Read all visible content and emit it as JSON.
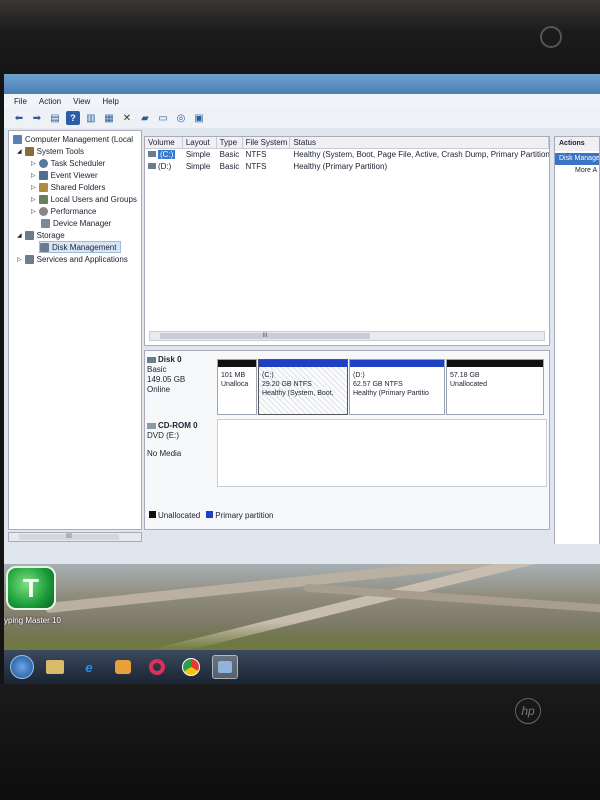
{
  "menu": [
    "File",
    "Action",
    "View",
    "Help"
  ],
  "toolbar": {
    "help_icon": "?"
  },
  "tree": {
    "items": [
      {
        "label": "Computer Management (Local"
      },
      {
        "label": "System Tools"
      },
      {
        "label": "Task Scheduler"
      },
      {
        "label": "Event Viewer"
      },
      {
        "label": "Shared Folders"
      },
      {
        "label": "Local Users and Groups"
      },
      {
        "label": "Performance"
      },
      {
        "label": "Device Manager"
      },
      {
        "label": "Storage"
      },
      {
        "label": "Disk Management"
      },
      {
        "label": "Services and Applications"
      }
    ],
    "scroll_label": "III"
  },
  "volume_table": {
    "headers": [
      "Volume",
      "Layout",
      "Type",
      "File System",
      "Status"
    ],
    "rows": [
      {
        "volume": "(C:)",
        "layout": "Simple",
        "type": "Basic",
        "fs": "NTFS",
        "status": "Healthy (System, Boot, Page File, Active, Crash Dump, Primary Partition"
      },
      {
        "volume": "(D:)",
        "layout": "Simple",
        "type": "Basic",
        "fs": "NTFS",
        "status": "Healthy (Primary Partition)"
      }
    ],
    "scroll_label": "III"
  },
  "disk0": {
    "name": "Disk 0",
    "type": "Basic",
    "size": "149.05 GB",
    "state": "Online",
    "partitions": [
      {
        "title": "",
        "line1": "101 MB",
        "line2": "Unalloca",
        "color": "#111111"
      },
      {
        "title": "(C:)",
        "line1": "29.20 GB NTFS",
        "line2": "Healthy (System, Boot,",
        "color": "#1f3fc4"
      },
      {
        "title": "(D:)",
        "line1": "62.57 GB NTFS",
        "line2": "Healthy (Primary Partitio",
        "color": "#1f3fc4"
      },
      {
        "title": "",
        "line1": "57.18 GB",
        "line2": "Unallocated",
        "color": "#111111"
      }
    ]
  },
  "cdrom": {
    "name": "CD-ROM 0",
    "drive": "DVD (E:)",
    "media": "No Media"
  },
  "legend": [
    {
      "label": "Unallocated",
      "color": "#111111"
    },
    {
      "label": "Primary partition",
      "color": "#1f3fc4"
    }
  ],
  "actions": {
    "header": "Actions",
    "section": "Disk Manage",
    "more": "More A"
  },
  "desktop": {
    "app_icon_glyph": "T",
    "app_label": "yping Master 10"
  },
  "taskbar": {
    "icons": [
      "windows-start-icon",
      "windows-explorer-icon",
      "internet-explorer-icon",
      "media-player-icon",
      "opera-icon",
      "chrome-icon",
      "computer-management-icon"
    ]
  },
  "brand": "hp"
}
